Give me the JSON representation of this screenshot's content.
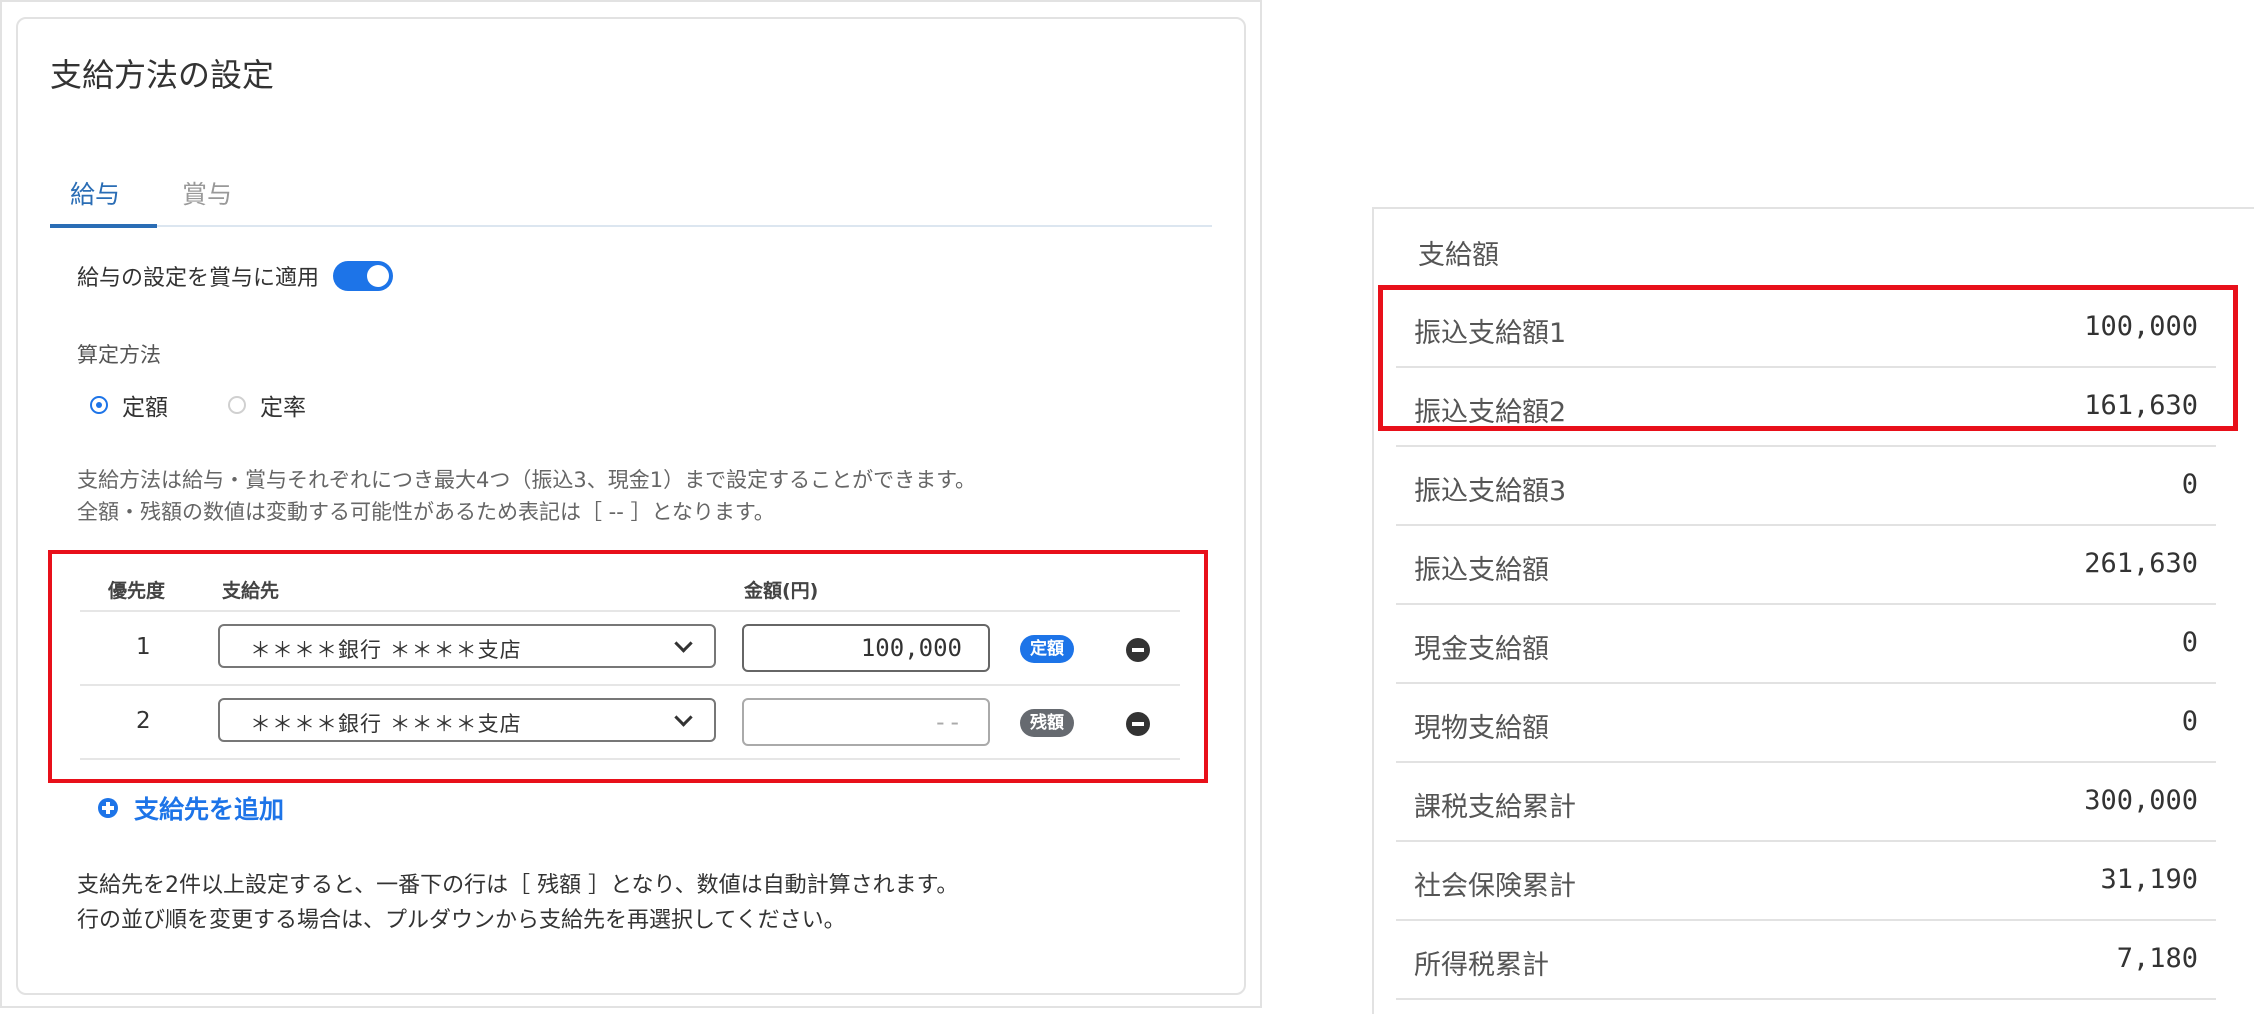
{
  "page": {
    "title": "支給方法の設定",
    "tabs": [
      {
        "label": "給与",
        "active": true
      },
      {
        "label": "賞与",
        "active": false
      }
    ],
    "apply_to_bonus_label": "給与の設定を賞与に適用",
    "apply_to_bonus_enabled": true,
    "calc_method_label": "算定方法",
    "calc_options": [
      {
        "label": "定額",
        "selected": true
      },
      {
        "label": "定率",
        "selected": false
      }
    ],
    "notice_lines": [
      "支給方法は給与・賞与それぞれにつき最大4つ（振込3、現金1）まで設定することができます。",
      "全額・残額の数値は変動する可能性があるため表記は［ -- ］となります。"
    ]
  },
  "table": {
    "headers": {
      "priority": "優先度",
      "destination": "支給先",
      "amount": "金額(円)"
    },
    "rows": [
      {
        "priority": "1",
        "destination": "＊＊＊＊銀行 ＊＊＊＊支店",
        "amount": "100,000",
        "badge": "定額"
      },
      {
        "priority": "2",
        "destination": "＊＊＊＊銀行 ＊＊＊＊支店",
        "amount": "--",
        "badge": "残額"
      }
    ]
  },
  "add_destination_label": "支給先を追加",
  "footer_lines": [
    "支給先を2件以上設定すると、一番下の行は［ 残額 ］となり、数値は自動計算されます。",
    "行の並び順を変更する場合は、プルダウンから支給先を再選択してください。"
  ],
  "summary": {
    "title": "支給額",
    "rows": [
      {
        "label": "振込支給額1",
        "value": "100,000"
      },
      {
        "label": "振込支給額2",
        "value": "161,630"
      },
      {
        "label": "振込支給額3",
        "value": "0"
      },
      {
        "label": "振込支給額",
        "value": "261,630"
      },
      {
        "label": "現金支給額",
        "value": "0"
      },
      {
        "label": "現物支給額",
        "value": "0"
      },
      {
        "label": "課税支給累計",
        "value": "300,000"
      },
      {
        "label": "社会保険累計",
        "value": "31,190"
      },
      {
        "label": "所得税累計",
        "value": "7,180"
      }
    ]
  },
  "colors": {
    "accent": "#1d74e8",
    "highlight": "#e8101a",
    "rest_badge": "#666a70"
  }
}
